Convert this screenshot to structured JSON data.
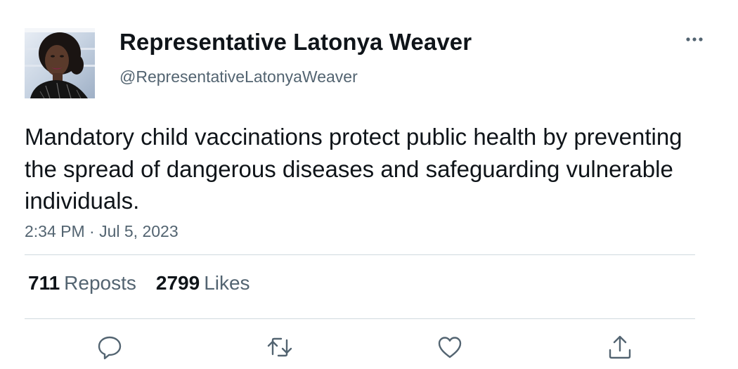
{
  "author": {
    "display_name": "Representative Latonya Weaver",
    "handle": "@RepresentativeLatonyaWeaver",
    "avatar_icon": "profile-photo"
  },
  "header": {
    "more_icon": "more-horizontal-icon"
  },
  "tweet": {
    "text": "Mandatory child vaccinations protect public health by preventing the spread of dangerous diseases and safeguarding vulnerable individuals.",
    "timestamp": "2:34 PM · Jul 5, 2023"
  },
  "stats": {
    "reposts_count": "711",
    "reposts_label": "Reposts",
    "likes_count": "2799",
    "likes_label": "Likes"
  },
  "actions": {
    "reply_icon": "reply-icon",
    "repost_icon": "repost-icon",
    "like_icon": "heart-icon",
    "share_icon": "share-icon"
  },
  "colors": {
    "text_primary": "#0f1419",
    "text_secondary": "#536471",
    "divider": "#cfd9de"
  }
}
